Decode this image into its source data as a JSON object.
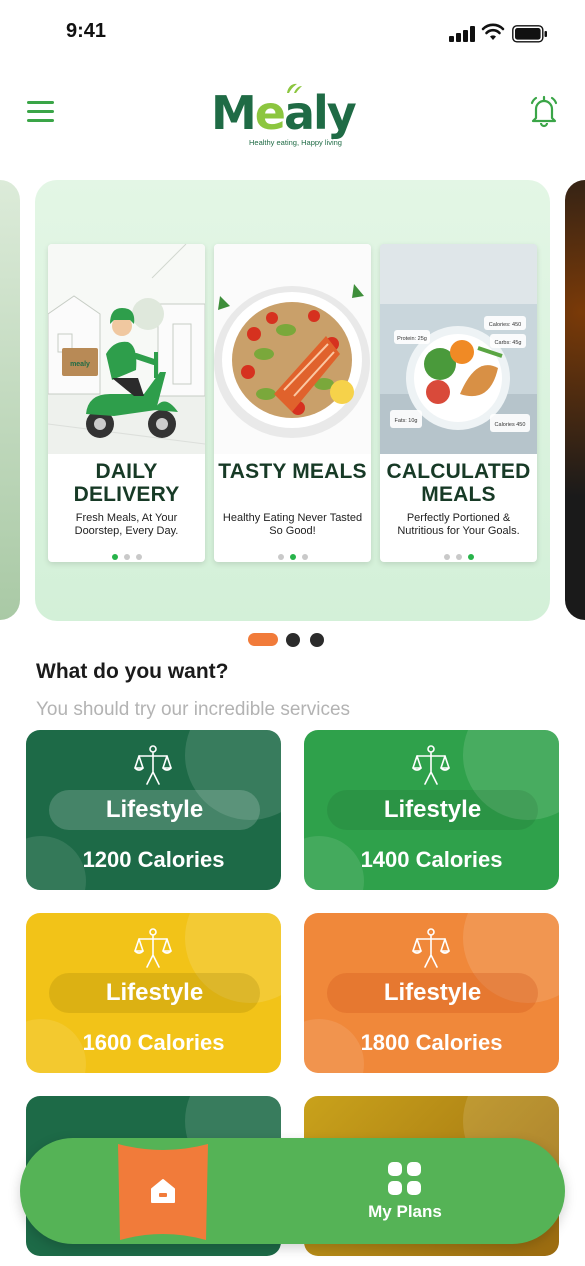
{
  "status_bar": {
    "time": "9:41",
    "signal_icon": "cellular-signal-icon",
    "wifi_icon": "wifi-icon",
    "battery_icon": "battery-icon"
  },
  "header": {
    "menu_icon": "hamburger-menu-icon",
    "logo_text_1": "M",
    "logo_text_2": "e",
    "logo_text_3": "aly",
    "logo_tagline": "Healthy eating, Happy living",
    "bell_icon": "bell-icon",
    "accent": "#3aa547"
  },
  "carousel": {
    "cards": [
      {
        "title": "DAILY DELIVERY",
        "subtitle": "Fresh Meals, At Your Doorstep, Every Day.",
        "active_dot": 0,
        "art": "delivery-scooter-illustration",
        "scooter_box_text": "mealy"
      },
      {
        "title": "TASTY MEALS",
        "subtitle": "Healthy Eating Never Tasted So Good!",
        "active_dot": 1,
        "art": "salmon-salad-plate-photo"
      },
      {
        "title": "CALCULATED MEALS",
        "subtitle": "Perfectly Portioned & Nutritious for Your Goals.",
        "active_dot": 2,
        "art": "nutrition-plate-photo",
        "nutrition_labels": {
          "protein": "Protein: 25g",
          "calories_top": "Calories: 450",
          "carbs": "Carbs: 45g",
          "fats": "Fats: 10g",
          "calories_bottom": "Calories 450"
        }
      }
    ],
    "pager": {
      "count": 3,
      "active": 0,
      "active_color": "#f17b3a",
      "inactive_color": "#2b2b2b"
    }
  },
  "section": {
    "title": "What do you want?",
    "subtitle": "You should try our incredible services"
  },
  "tiles": [
    {
      "label": "Lifestyle",
      "calories": "1200 Calories",
      "color": "#1d6a47",
      "icon": "scale-person-icon"
    },
    {
      "label": "Lifestyle",
      "calories": "1400 Calories",
      "color": "#2fa14b",
      "icon": "scale-person-icon"
    },
    {
      "label": "Lifestyle",
      "calories": "1600 Calories",
      "color": "#f2c318",
      "icon": "scale-person-icon"
    },
    {
      "label": "Lifestyle",
      "calories": "1800 Calories",
      "color": "#f0883a",
      "icon": "scale-person-icon"
    }
  ],
  "partial_tiles": [
    {
      "color": "#1d6a47"
    },
    {
      "color": "#b99a18"
    }
  ],
  "bottom_nav": {
    "home_icon": "home-icon",
    "home_bg": "#f17b3a",
    "plans_icon": "grid-icon",
    "plans_label": "My Plans",
    "bg": "#55b356"
  }
}
